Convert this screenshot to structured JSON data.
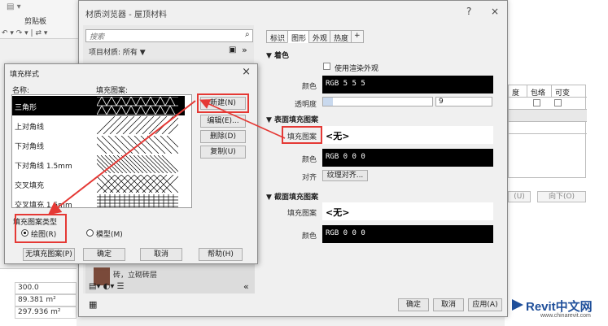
{
  "background": {
    "ribbon_clipboard": "剪贴板",
    "right_table_headers": [
      "度",
      "包络",
      "可变"
    ],
    "right_buttons": [
      "(U)",
      "向下(O)"
    ],
    "left_values": [
      "300.0",
      "89.381 m²",
      "297.936 m²"
    ]
  },
  "material_browser": {
    "title": "材质浏览器 - 屋顶材料",
    "help": "?",
    "close": "×",
    "search_placeholder": "搜索",
    "project_materials": "项目材质: 所有 ▼",
    "brick_item": "砖，立砌砖层",
    "tabs": [
      "标识",
      "图形",
      "外观",
      "热度",
      "+"
    ],
    "shading": {
      "header": "▼ 着色",
      "use_render_appearance": "使用渲染外观",
      "color_label": "颜色",
      "color_value": "RGB 5 5 5",
      "transparency_label": "透明度",
      "transparency_value": "9"
    },
    "surface_pattern": {
      "header": "▼ 表面填充图案",
      "fill_label": "填充图案",
      "fill_value": "<无>",
      "color_label": "颜色",
      "color_value": "RGB 0 0 0",
      "align_label": "对齐",
      "align_button": "纹理对齐..."
    },
    "cut_pattern": {
      "header": "▼ 截面填充图案",
      "fill_label": "填充图案",
      "fill_value": "<无>",
      "color_label": "颜色",
      "color_value": "RGB 0 0 0"
    },
    "footer": {
      "ok": "确定",
      "cancel": "取消",
      "apply": "应用(A)"
    }
  },
  "fill_patterns": {
    "title": "填充样式",
    "close": "×",
    "col_name": "名称:",
    "col_pattern": "填充图案:",
    "rows": [
      {
        "name": "三角形",
        "pattern": "triangle"
      },
      {
        "name": "上对角线",
        "pattern": "diag-up"
      },
      {
        "name": "下对角线",
        "pattern": "diag-down"
      },
      {
        "name": "下对角线 1.5mm",
        "pattern": "diag-down-dense"
      },
      {
        "name": "交叉填充",
        "pattern": "cross"
      },
      {
        "name": "交叉填充 1.5mm",
        "pattern": "grid"
      }
    ],
    "buttons": {
      "new": "新建(N)",
      "edit": "编辑(E)...",
      "delete": "删除(D)",
      "copy": "复制(U)"
    },
    "type_label": "填充图案类型",
    "radio_drafting": "绘图(R)",
    "radio_model": "模型(M)",
    "no_fill": "无填充图案(P)",
    "ok": "确定",
    "cancel": "取消",
    "help": "帮助(H)"
  },
  "watermark": {
    "logo": "Revit中文网",
    "url": "www.chinarevit.com"
  }
}
